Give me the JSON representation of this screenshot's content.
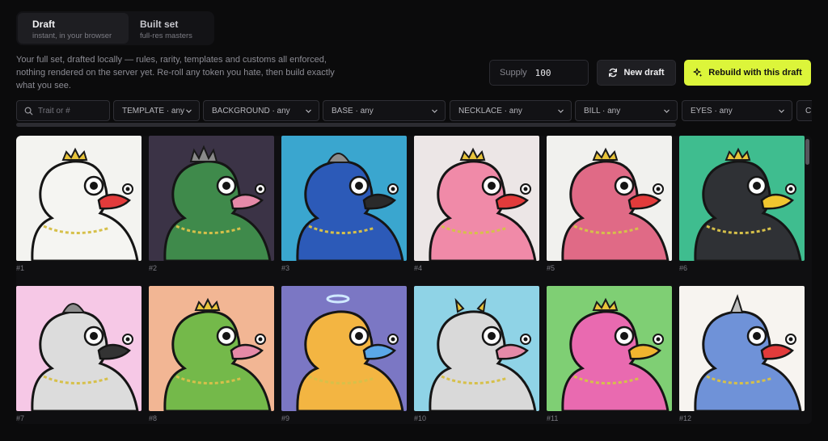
{
  "mode_tabs": [
    {
      "title": "Draft",
      "subtitle": "instant, in your browser"
    },
    {
      "title": "Built set",
      "subtitle": "full-res masters"
    }
  ],
  "intro": "Your full set, drafted locally — rules, rarity, templates and customs all enforced, nothing rendered on the server yet. Re-roll any token you hate, then build exactly what you see.",
  "supply": {
    "label": "Supply",
    "value": "100"
  },
  "buttons": {
    "new_draft": "New draft",
    "rebuild": "Rebuild with this draft"
  },
  "search": {
    "placeholder": "Trait or #"
  },
  "filters": [
    "TEMPLATE · any",
    "BACKGROUND · any",
    "BASE · any",
    "NECKLACE · any",
    "BILL · any",
    "EYES · any",
    "C"
  ],
  "colors": {
    "accent": "#dcf53a",
    "bg": "#0b0b0c",
    "panel": "#121215"
  },
  "tokens": [
    {
      "label": "#1",
      "bg": "#f3f3f0",
      "body": "#f5f5f2",
      "bill": "#e23b3b",
      "hat": "crown"
    },
    {
      "label": "#2",
      "bg": "#3b3346",
      "body": "#3f8a4b",
      "bill": "#e58aa8",
      "hat": "spikes"
    },
    {
      "label": "#3",
      "bg": "#3aa6cf",
      "body": "#2c5ab8",
      "bill": "#2a2a2a",
      "hat": "dome"
    },
    {
      "label": "#4",
      "bg": "#ece6e6",
      "body": "#f08aa8",
      "bill": "#e23b3b",
      "hat": "crown"
    },
    {
      "label": "#5",
      "bg": "#f1f1ee",
      "body": "#e06a86",
      "bill": "#e23b3b",
      "hat": "crown"
    },
    {
      "label": "#6",
      "bg": "#3fbd8f",
      "body": "#2f3135",
      "bill": "#f0c62f",
      "hat": "crown"
    },
    {
      "label": "#7",
      "bg": "#f6c8e6",
      "body": "#dcdcdc",
      "bill": "#333333",
      "hat": "dome"
    },
    {
      "label": "#8",
      "bg": "#f2b694",
      "body": "#74b94a",
      "bill": "#e58aa8",
      "hat": "crown"
    },
    {
      "label": "#9",
      "bg": "#7b77c4",
      "body": "#f3b542",
      "bill": "#5aa7e8",
      "hat": "halo"
    },
    {
      "label": "#10",
      "bg": "#8fd3e6",
      "body": "#d9d9d9",
      "bill": "#e58aa8",
      "hat": "horns"
    },
    {
      "label": "#11",
      "bg": "#7fcf74",
      "body": "#e96ab0",
      "bill": "#f0b42f",
      "hat": "crown"
    },
    {
      "label": "#12",
      "bg": "#f7f4f0",
      "body": "#6f92d8",
      "bill": "#e23b3b",
      "hat": "horn"
    }
  ]
}
